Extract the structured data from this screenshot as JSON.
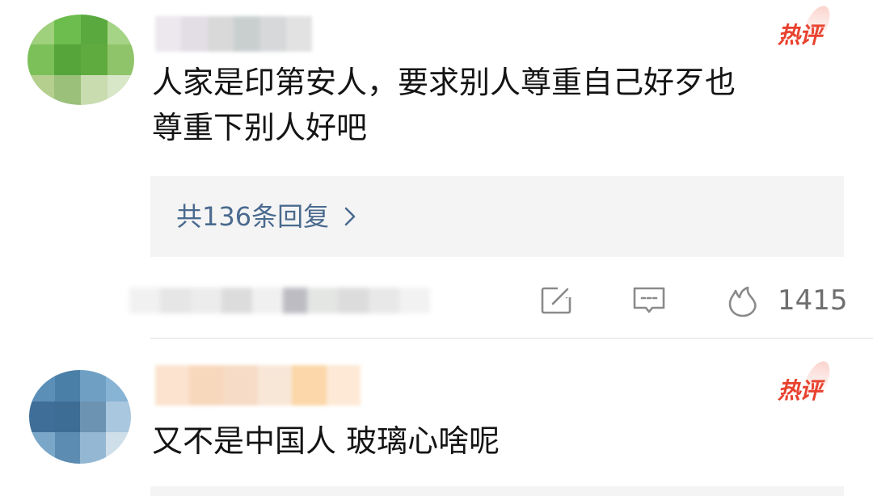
{
  "comments": [
    {
      "badge": "热评",
      "text_lines": [
        "人家是印第安人，要求别人尊重自己好歹也",
        "尊重下别人好吧"
      ],
      "replies_label": "共136条回复",
      "like_count": "1415",
      "avatar_colors": [
        "#9fd07c",
        "#6dbd4e",
        "#5aa93e",
        "#a6d486",
        "#7cc05a",
        "#56a53a",
        "#60ab3f",
        "#8fc46a",
        "#b5cf8e",
        "#9ac07a",
        "#c8dcb0",
        "#d7e7c8"
      ],
      "username_colors": [
        "#ece8ee",
        "#e3dde6",
        "#d9d9d9",
        "#c9cfcf",
        "#d6d8da",
        "#e2e2e2"
      ]
    },
    {
      "badge": "热评",
      "text_lines": [
        "又不是中国人 玻璃心啥呢"
      ],
      "avatar_colors": [
        "#5b8fb8",
        "#4a7fa8",
        "#6fa0c4",
        "#87b3d4",
        "#3f6f99",
        "#3d6c94",
        "#6d93b3",
        "#a9c7de",
        "#7aa6c8",
        "#5c8cb2",
        "#94b8d3",
        "#cfdfea"
      ],
      "username_colors": [
        "#fbe3cf",
        "#f8d8bd",
        "#f6dcc6",
        "#f8e7d7",
        "#fbd7a9",
        "#fde9d6"
      ]
    }
  ],
  "time_blur_colors": [
    "#f1f1f1",
    "#e6e6e6",
    "#ececec",
    "#dcdcdc",
    "#f0f0f0",
    "#bdbcc3",
    "#e3e6e3",
    "#dcdcdc",
    "#e8e8e8",
    "#f2f2f2"
  ],
  "colors": {
    "badge_red": "#e8412e",
    "link_blue": "#4a6a8f",
    "reply_bg": "#f4f4f4",
    "icon_gray": "#8a8a8a"
  },
  "icons": [
    "share-icon",
    "comment-icon",
    "flame-like-icon",
    "chevron-right-icon"
  ]
}
